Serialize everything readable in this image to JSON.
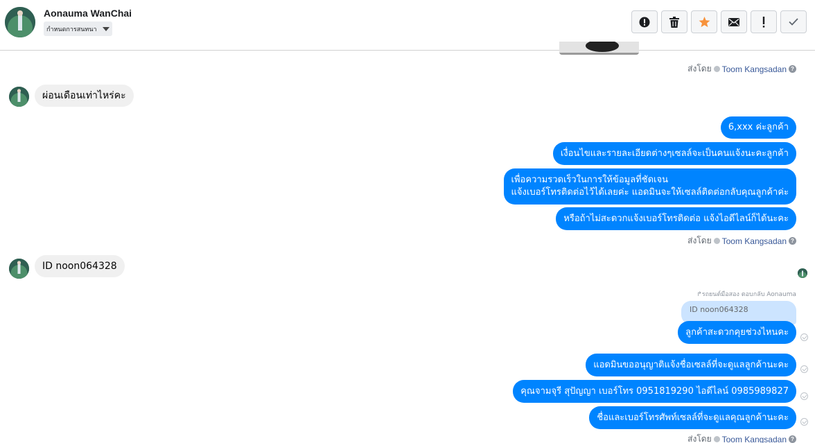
{
  "header": {
    "contact_name": "Aonauma WanChai",
    "assign_label": "กำหนดการสนทนา",
    "actions": [
      {
        "name": "spam-button",
        "icon": "alert-circle-icon"
      },
      {
        "name": "delete-button",
        "icon": "trash-icon"
      },
      {
        "name": "star-button",
        "icon": "star-icon",
        "color": "#f7923b"
      },
      {
        "name": "mark-unread-button",
        "icon": "envelope-icon"
      },
      {
        "name": "follow-up-button",
        "icon": "exclamation-icon"
      },
      {
        "name": "done-button",
        "icon": "check-icon"
      }
    ]
  },
  "sent_by_prefix": "ส่งโดย",
  "sent_by_name": "Toom Kangsadan",
  "messages": {
    "in_1": "ผ่อนเดือนเท่าไหร่คะ",
    "out_1": "6,xxx ค่ะลูกค้า",
    "out_2": "เงื่อนไขและรายละเอียดต่างๆเซลล์จะเป็นคนแจ้งนะคะลูกค้า",
    "out_3_line1": "เพื่อความรวดเร็วในการให้ข้อมูลที่ชัดเจน",
    "out_3_line2": "แจ้งเบอร์โทรติดต่อไว้ได้เลยค่ะ แอดมินจะให้เซลล์ติดต่อกลับคุณลูกค้าค่ะ",
    "out_4": "หรือถ้าไม่สะดวกแจ้งเบอร์โทรติดต่อ แจ้งไอดีไลน์ก็ได้นะคะ",
    "in_2": "ID noon064328",
    "reply_note": "รถยนต์มือสอง ตอบกลับ Aonauma",
    "quoted": "ID noon064328",
    "out_5": "ลูกค้าสะดวกคุยช่วงไหนคะ",
    "out_6": "แอดมินขออนุญาติแจ้งชื่อเซลล์ที่จะดูแลลูกค้านะคะ",
    "out_7": "คุณจามจุรี สุปัญญา เบอร์โทร 0951819290  ไอดีไลน์ 0985989827",
    "out_8": "ชื่อและเบอร์โทรศัพท์เซลล์ที่จะดูแลคุณลูกค้านะคะ"
  },
  "colors": {
    "outgoing_bubble": "#0084ff",
    "incoming_bubble": "#f0f0f0",
    "link": "#385898",
    "star": "#f7923b"
  }
}
